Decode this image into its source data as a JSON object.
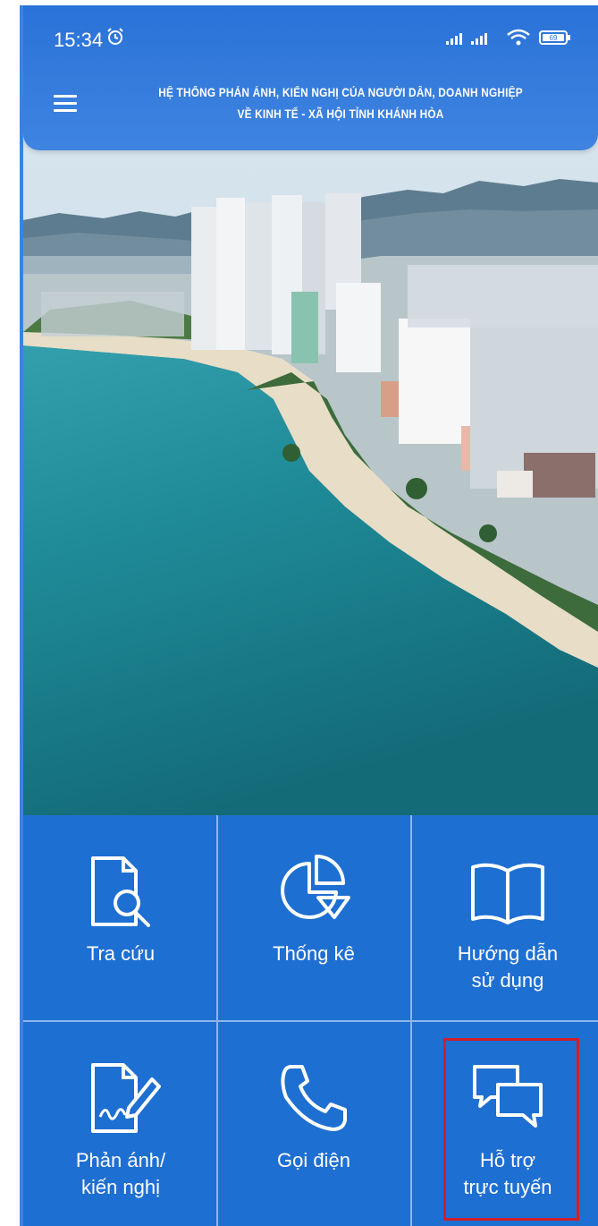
{
  "status": {
    "time": "15:34",
    "battery": "69"
  },
  "header": {
    "title_line1": "HỆ THỐNG PHẢN ÁNH, KIẾN NGHỊ CỦA NGƯỜI DÂN, DOANH NGHIỆP",
    "title_line2": "VỀ KINH TẾ - XÃ HỘI TỈNH KHÁNH HÒA"
  },
  "grid": {
    "items": [
      {
        "label_line1": "Tra cứu",
        "label_line2": "",
        "icon": "search-document-icon"
      },
      {
        "label_line1": "Thống kê",
        "label_line2": "",
        "icon": "pie-chart-icon"
      },
      {
        "label_line1": "Hướng dẫn",
        "label_line2": "sử dụng",
        "icon": "book-icon"
      },
      {
        "label_line1": "Phản ánh/",
        "label_line2": "kiến nghị",
        "icon": "sign-document-icon"
      },
      {
        "label_line1": "Gọi điện",
        "label_line2": "",
        "icon": "phone-icon"
      },
      {
        "label_line1": "Hỗ trợ",
        "label_line2": "trực tuyến",
        "icon": "chat-bubbles-icon"
      }
    ]
  },
  "colors": {
    "primary": "#1e6fd2",
    "header": "#2f78db",
    "highlight": "#d0202a"
  }
}
